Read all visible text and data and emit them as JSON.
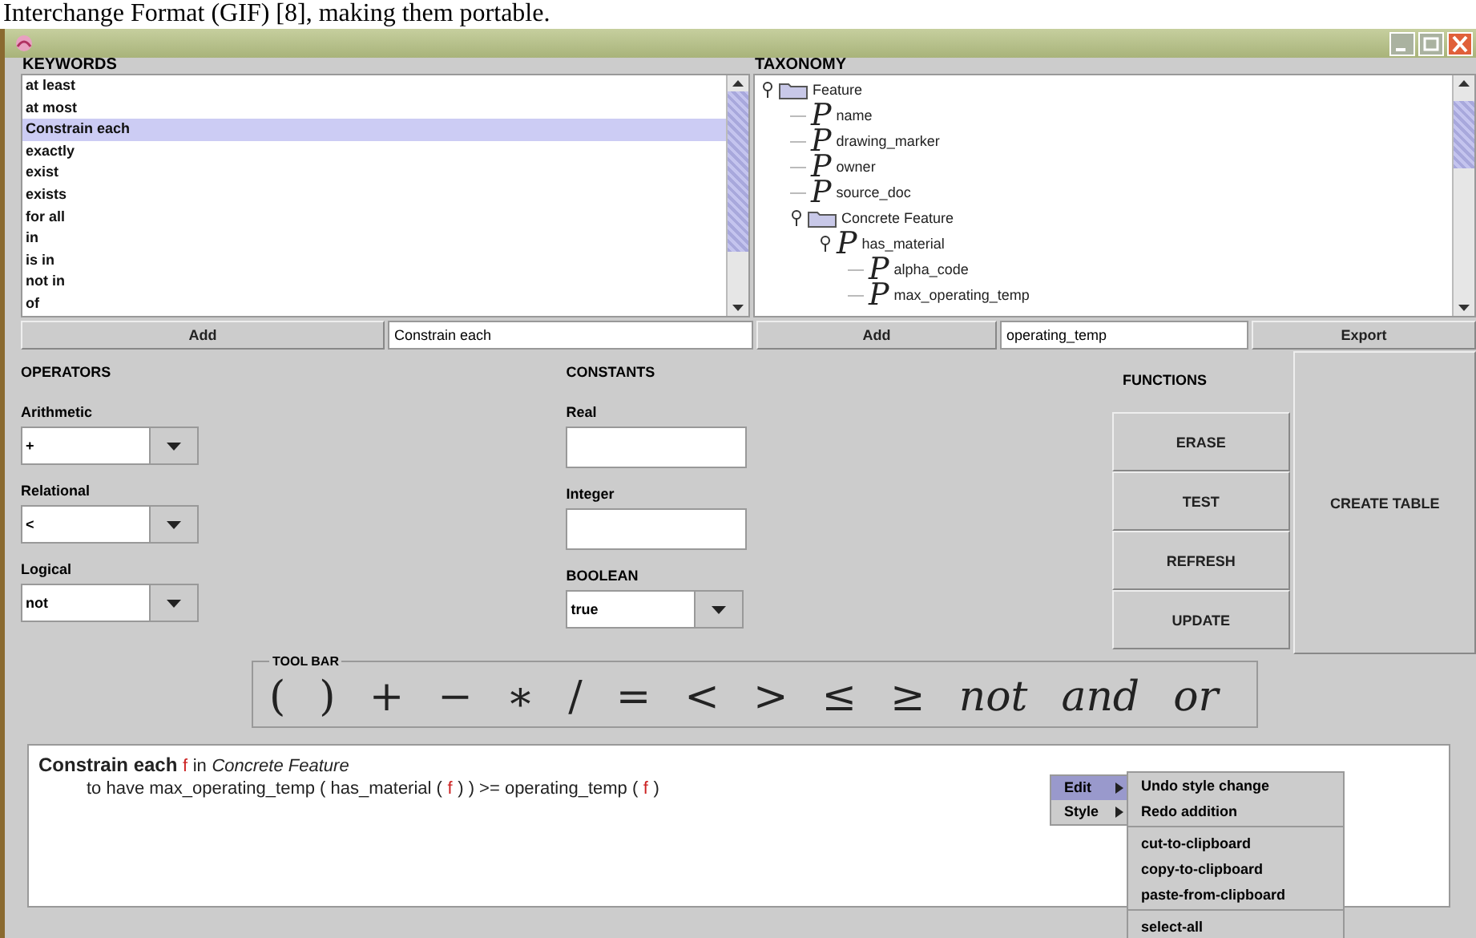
{
  "page_text": "Interchange Format (GIF) [8], making them portable.",
  "keywords": {
    "heading": "KEYWORDS",
    "items": [
      {
        "label": "at least",
        "selected": false
      },
      {
        "label": "at most",
        "selected": false
      },
      {
        "label": "Constrain each",
        "selected": true
      },
      {
        "label": "exactly",
        "selected": false
      },
      {
        "label": "exist",
        "selected": false
      },
      {
        "label": "exists",
        "selected": false
      },
      {
        "label": "for all",
        "selected": false
      },
      {
        "label": "in",
        "selected": false
      },
      {
        "label": "is in",
        "selected": false
      },
      {
        "label": "not in",
        "selected": false
      },
      {
        "label": "of",
        "selected": false
      }
    ],
    "add_button": "Add",
    "field_value": "Constrain each"
  },
  "taxonomy": {
    "heading": "TAXONOMY",
    "tree": [
      {
        "label": "Feature",
        "kind": "folder",
        "expanded": true,
        "children": [
          {
            "label": "name",
            "kind": "property",
            "glyph": "P"
          },
          {
            "label": "drawing_marker",
            "kind": "property",
            "glyph": "P"
          },
          {
            "label": "owner",
            "kind": "property",
            "glyph": "P"
          },
          {
            "label": "source_doc",
            "kind": "property",
            "glyph": "P"
          },
          {
            "label": "Concrete Feature",
            "kind": "folder",
            "expanded": true,
            "children": [
              {
                "label": "has_material",
                "kind": "property",
                "glyph": "P",
                "expanded": true,
                "children": [
                  {
                    "label": "alpha_code",
                    "kind": "property",
                    "glyph": "P"
                  },
                  {
                    "label": "max_operating_temp",
                    "kind": "property",
                    "glyph": "P"
                  }
                ]
              }
            ]
          }
        ]
      }
    ],
    "add_button": "Add",
    "field_value": "operating_temp"
  },
  "export_button": "Export",
  "operators": {
    "heading": "OPERATORS",
    "groups": [
      {
        "label": "Arithmetic",
        "value": "+"
      },
      {
        "label": "Relational",
        "value": "<"
      },
      {
        "label": "Logical",
        "value": "not"
      }
    ]
  },
  "constants": {
    "heading": "CONSTANTS",
    "fields": [
      {
        "kind": "text",
        "label": "Real"
      },
      {
        "kind": "text",
        "label": "Integer"
      },
      {
        "kind": "select",
        "label": "BOOLEAN",
        "value": "true"
      }
    ]
  },
  "functions": {
    "heading": "FUNCTIONS",
    "buttons": [
      "ERASE",
      "TEST",
      "REFRESH",
      "UPDATE"
    ]
  },
  "create_table_button": "CREATE TABLE",
  "toolbar": {
    "title": "TOOL BAR",
    "symbols": [
      {
        "text": "(",
        "kind": "symbol"
      },
      {
        "text": ")",
        "kind": "symbol"
      },
      {
        "text": "+",
        "kind": "symbol"
      },
      {
        "text": "−",
        "kind": "symbol"
      },
      {
        "text": "∗",
        "kind": "symbol"
      },
      {
        "text": "/",
        "kind": "symbol"
      },
      {
        "text": "=",
        "kind": "symbol"
      },
      {
        "text": "<",
        "kind": "symbol"
      },
      {
        "text": ">",
        "kind": "symbol"
      },
      {
        "text": "≤",
        "kind": "symbol"
      },
      {
        "text": "≥",
        "kind": "symbol"
      },
      {
        "text": "not",
        "kind": "word"
      },
      {
        "text": "and",
        "kind": "word"
      },
      {
        "text": "or",
        "kind": "word"
      }
    ]
  },
  "editor": {
    "lines": [
      [
        {
          "text": "Constrain each",
          "kind": "keyword"
        },
        {
          "text": "f",
          "kind": "variable"
        },
        {
          "text": "in",
          "kind": "plain"
        },
        {
          "text": "Concrete Feature",
          "kind": "class"
        }
      ],
      [
        {
          "text": "to have max_operating_temp ( has_material (",
          "kind": "plain"
        },
        {
          "text": "f",
          "kind": "variable"
        },
        {
          "text": ") ) >= operating_temp (",
          "kind": "plain"
        },
        {
          "text": "f",
          "kind": "variable"
        },
        {
          "text": ")",
          "kind": "plain"
        }
      ]
    ]
  },
  "context_menu": {
    "items": [
      {
        "label": "Edit",
        "selected": true
      },
      {
        "label": "Style",
        "selected": false
      }
    ],
    "submenu": [
      {
        "kind": "item",
        "label": "Undo style change"
      },
      {
        "kind": "item",
        "label": "Redo addition"
      },
      {
        "kind": "separator"
      },
      {
        "kind": "item",
        "label": "cut-to-clipboard"
      },
      {
        "kind": "item",
        "label": "copy-to-clipboard"
      },
      {
        "kind": "item",
        "label": "paste-from-clipboard"
      },
      {
        "kind": "separator"
      },
      {
        "kind": "item",
        "label": "select-all"
      }
    ]
  }
}
